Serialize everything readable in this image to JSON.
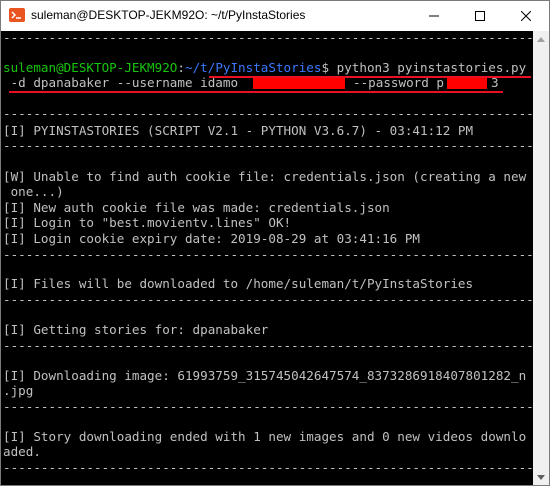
{
  "window": {
    "title": "suleman@DESKTOP-JEKM92O: ~/t/PyInstaStories",
    "controls": {
      "minimize": "minimize-icon",
      "maximize": "maximize-icon",
      "close": "close-icon"
    }
  },
  "terminal": {
    "prompt_user": "suleman@DESKTOP-JEKM92O",
    "prompt_sep": ":",
    "prompt_path": "~/t/PyInstaStories",
    "prompt_dollar": "$ ",
    "command": "python3 pyinstastories.py",
    "command_cont_1": " -d dpanabaker --username idamo",
    "command_cont_2": "--password p",
    "command_cont_3": "3",
    "separator": "------------------------------------------------------------------------",
    "lines": {
      "header": "[I] PYINSTASTORIES (SCRIPT V2.1 - PYTHON V3.6.7) - 03:41:12 PM",
      "warn_1": "[W] Unable to find auth cookie file: credentials.json (creating a new",
      "warn_2": " one...)",
      "new_cookie": "[I] New auth cookie file was made: credentials.json",
      "login": "[I] Login to \"best.movientv.lines\" OK!",
      "expiry": "[I] Login cookie expiry date: 2019-08-29 at 03:41:16 PM",
      "download_dir": "[I] Files will be downloaded to /home/suleman/t/PyInstaStories",
      "getting": "[I] Getting stories for: dpanabaker",
      "dl_image_1": "[I] Downloading image: 61993759_315745042647574_8373286918407801282_n",
      "dl_image_2": ".jpg",
      "ended_1": "[I] Story downloading ended with 1 new images and 0 new videos downlo",
      "ended_2": "aded."
    }
  },
  "colors": {
    "prompt_user": "#16c60c",
    "prompt_path": "#3b78ff",
    "text": "#c0c0c0",
    "background": "#000000",
    "annotation": "#e81123"
  }
}
